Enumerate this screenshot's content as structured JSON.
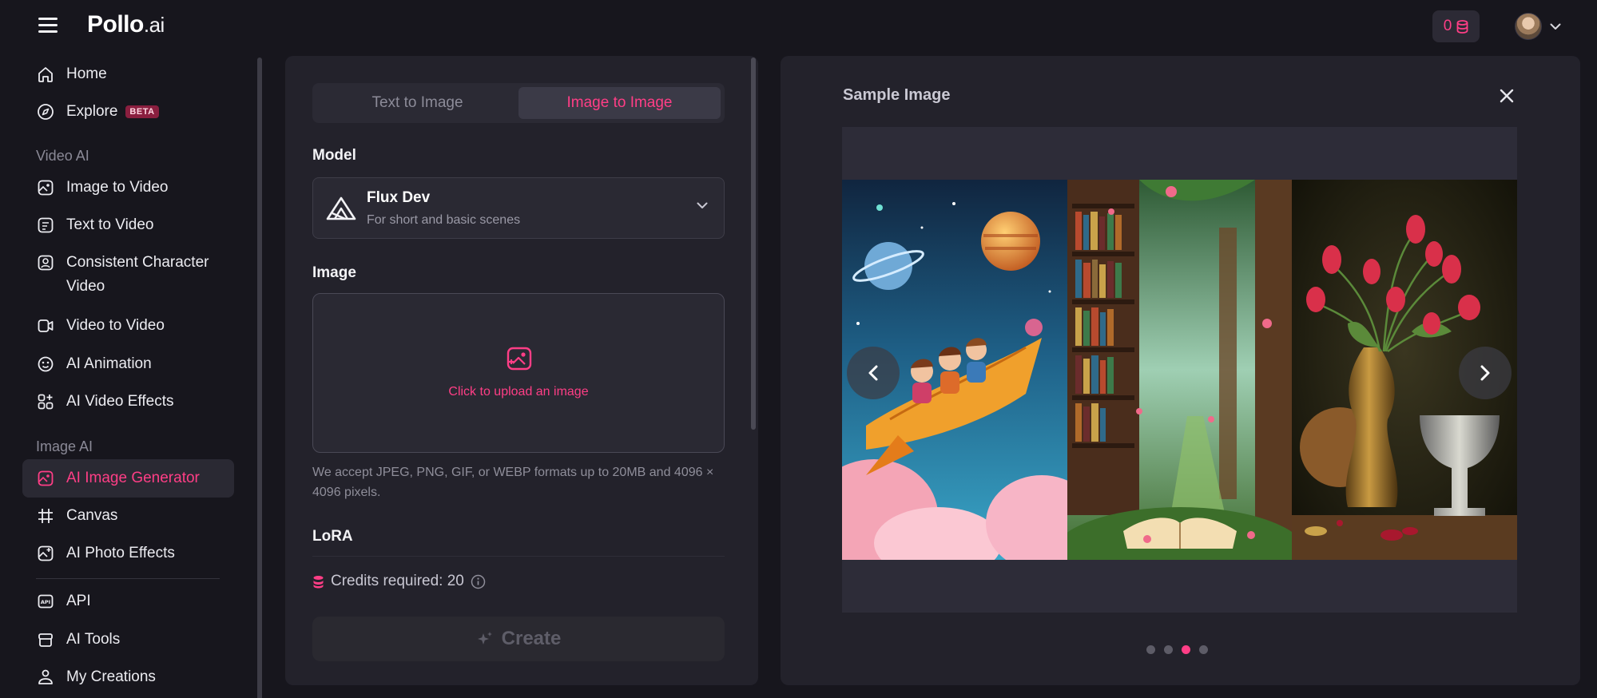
{
  "header": {
    "logo_main": "Pollo",
    "logo_suffix": ".ai",
    "credit_count": "0",
    "menu_icon": "hamburger-icon",
    "coin_icon": "coin-stack-icon"
  },
  "sidebar": {
    "top_items": [
      {
        "label": "Home",
        "icon": "home-icon"
      },
      {
        "label": "Explore",
        "icon": "compass-icon",
        "badge": "BETA"
      }
    ],
    "video_section_label": "Video AI",
    "video_items": [
      {
        "label": "Image to Video",
        "icon": "image-video-icon"
      },
      {
        "label": "Text to Video",
        "icon": "text-video-icon"
      },
      {
        "label": "Consistent Character Video",
        "icon": "character-icon"
      },
      {
        "label": "Video to Video",
        "icon": "video-icon"
      },
      {
        "label": "AI Animation",
        "icon": "animation-icon"
      },
      {
        "label": "AI Video Effects",
        "icon": "effects-grid-icon"
      }
    ],
    "image_section_label": "Image AI",
    "image_items": [
      {
        "label": "AI Image Generator",
        "icon": "image-generator-icon",
        "active": true
      },
      {
        "label": "Canvas",
        "icon": "canvas-hash-icon"
      },
      {
        "label": "AI Photo Effects",
        "icon": "photo-effects-icon"
      }
    ],
    "bottom_items": [
      {
        "label": "API",
        "icon": "api-icon"
      },
      {
        "label": "AI Tools",
        "icon": "tools-icon"
      },
      {
        "label": "My Creations",
        "icon": "creations-icon"
      }
    ]
  },
  "form": {
    "tabs": [
      {
        "label": "Text to Image",
        "active": false
      },
      {
        "label": "Image to Image",
        "active": true
      }
    ],
    "model_label": "Model",
    "model": {
      "name": "Flux Dev",
      "description": "For short and basic scenes"
    },
    "image_label": "Image",
    "upload_text": "Click to upload an image",
    "hint": "We accept JPEG, PNG, GIF, or WEBP formats up to 20MB and 4096 × 4096 pixels.",
    "lora_label": "LoRA",
    "credits_text": "Credits required: 20",
    "create_label": "Create"
  },
  "sample": {
    "title": "Sample Image",
    "active_dot": 3,
    "dot_count": 4
  },
  "colors": {
    "accent": "#ff3e86",
    "background": "#17161d",
    "panel": "#23222b"
  }
}
